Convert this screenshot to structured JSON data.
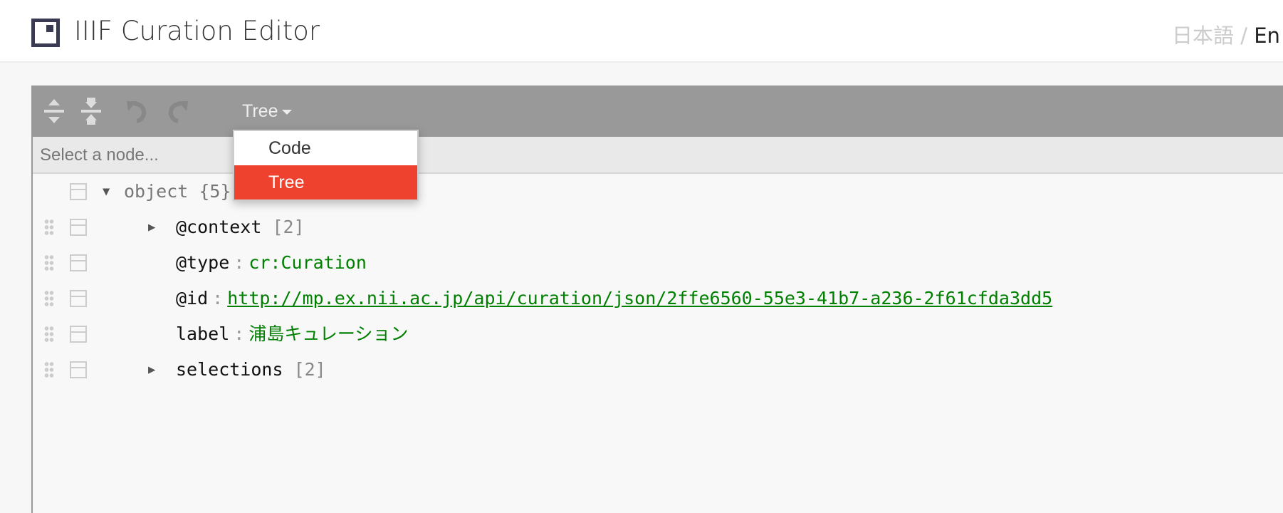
{
  "header": {
    "title": "IIIF Curation Editor",
    "lang_ja": "日本語",
    "lang_sep": " / ",
    "lang_en": "En"
  },
  "toolbar": {
    "expand_all": "expand-all-icon",
    "collapse_all": "collapse-all-icon",
    "undo": "undo-icon",
    "redo": "redo-icon",
    "mode_label": "Tree"
  },
  "navbar": {
    "placeholder": "Select a node..."
  },
  "dropdown": {
    "items": [
      {
        "label": "Code",
        "selected": false
      },
      {
        "label": "Tree",
        "selected": true
      }
    ],
    "accent": "#ee422e"
  },
  "tree": {
    "root": {
      "key": "object",
      "count": "{5}"
    },
    "rows": [
      {
        "key": "@context",
        "count": "[2]"
      },
      {
        "key": "@type",
        "value": "cr:Curation"
      },
      {
        "key": "@id",
        "value": "http://mp.ex.nii.ac.jp/api/curation/json/2ffe6560-55e3-41b7-a236-2f61cfda3dd5"
      },
      {
        "key": "label",
        "value": "浦島キュレーション"
      },
      {
        "key": "selections",
        "count": "[2]"
      }
    ],
    "separator": ":"
  }
}
